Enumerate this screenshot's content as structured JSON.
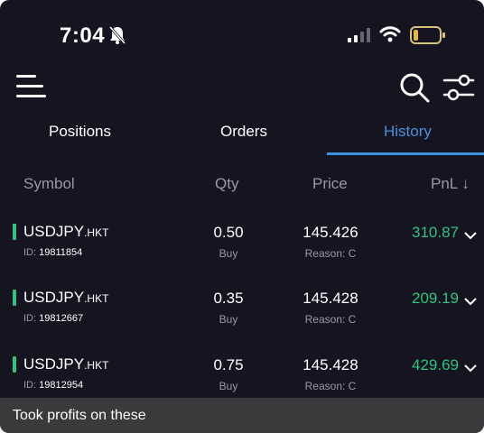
{
  "status_bar": {
    "time": "7:04",
    "icons": [
      "bell-muted-icon",
      "signal-icon",
      "wifi-icon",
      "battery-icon"
    ]
  },
  "toolbar": {
    "icons": [
      "menu-icon",
      "search-icon",
      "filter-icon"
    ]
  },
  "tabs": [
    {
      "label": "Positions",
      "active": false
    },
    {
      "label": "Orders",
      "active": false
    },
    {
      "label": "History",
      "active": true
    }
  ],
  "table": {
    "headers": {
      "symbol": "Symbol",
      "qty": "Qty",
      "price": "Price",
      "pnl": "PnL ↓"
    },
    "rows": [
      {
        "symbol": "USDJPY",
        "suffix": ".HKT",
        "id_label": "ID:",
        "id": "19811854",
        "qty": "0.50",
        "side": "Buy",
        "price": "145.426",
        "reason": "Reason:  C",
        "pnl": "310.87"
      },
      {
        "symbol": "USDJPY",
        "suffix": ".HKT",
        "id_label": "ID:",
        "id": "19812667",
        "qty": "0.35",
        "side": "Buy",
        "price": "145.428",
        "reason": "Reason:  C",
        "pnl": "209.19"
      },
      {
        "symbol": "USDJPY",
        "suffix": ".HKT",
        "id_label": "ID:",
        "id": "19812954",
        "qty": "0.75",
        "side": "Buy",
        "price": "145.428",
        "reason": "Reason:  C",
        "pnl": "429.69"
      }
    ]
  },
  "caption": "Took profits on these",
  "colors": {
    "background": "#151521",
    "accent": "#3f8fe0",
    "profit": "#2fc27b",
    "muted_text": "#9a9aa6",
    "caption_bg": "#3a3a3d"
  }
}
